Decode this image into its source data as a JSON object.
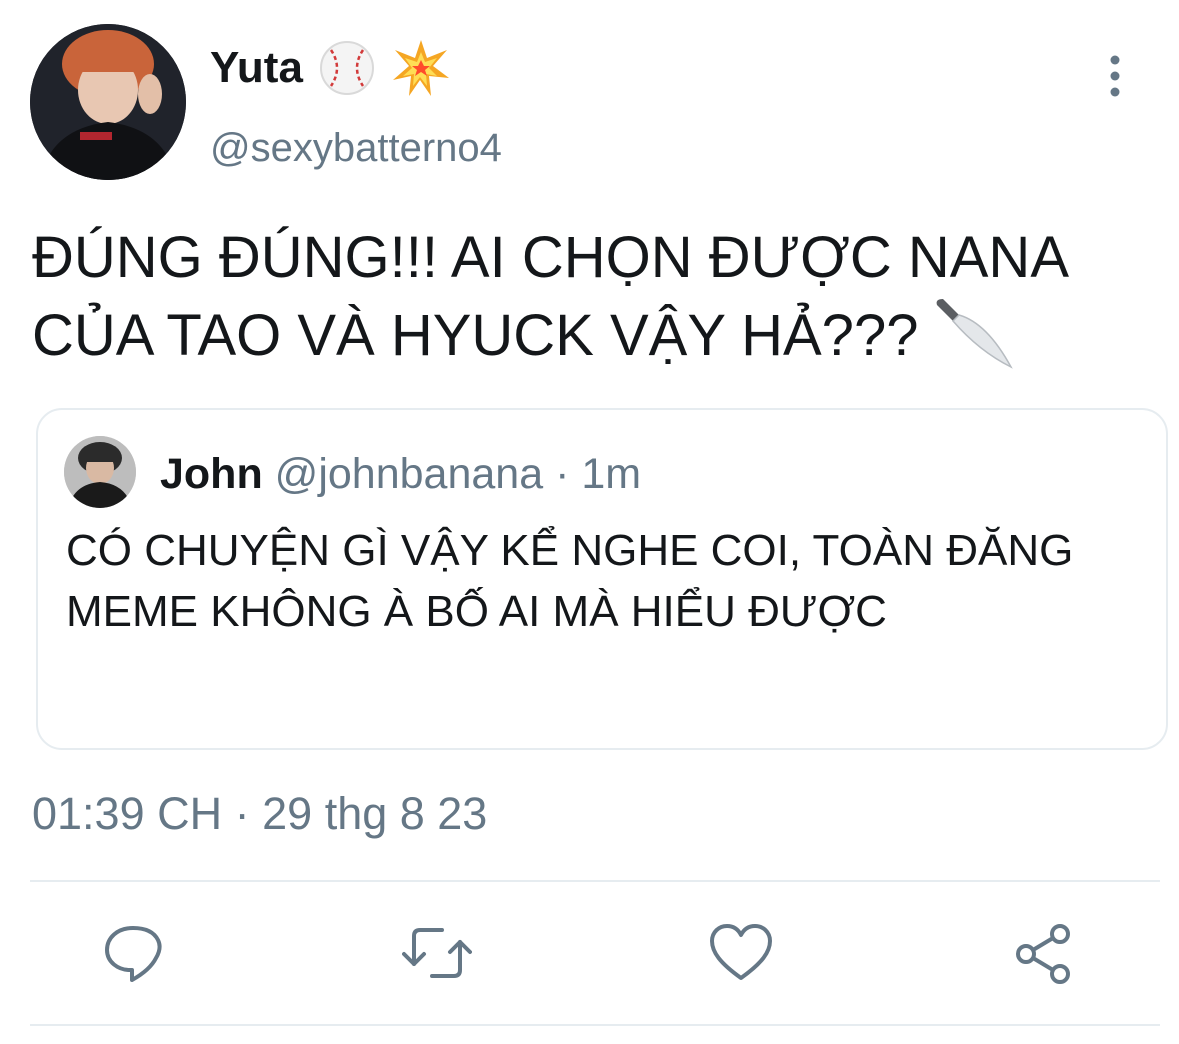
{
  "author": {
    "display_name": "Yuta",
    "handle": "@sexybatterno4",
    "name_emojis": [
      "baseball-emoji",
      "collision-emoji"
    ]
  },
  "tweet": {
    "line1": "ĐÚNG ĐÚNG!!! AI CHỌN ĐƯỢC NANA",
    "line2": "CỦA TAO VÀ HYUCK VẬY HẢ???",
    "trailing_emoji": "kitchen-knife-emoji"
  },
  "quoted_tweet": {
    "name": "John",
    "handle": "@johnbanana",
    "separator": "·",
    "time": "1m",
    "text": "CÓ CHUYỆN GÌ VẬY KỂ NGHE COI, TOÀN ĐĂNG MEME KHÔNG À BỐ AI MÀ HIỂU ĐƯỢC"
  },
  "meta": {
    "time": "01:39 CH",
    "separator": "·",
    "date": "29 thg 8 23"
  },
  "actions": [
    {
      "name": "reply",
      "icon": "reply-icon"
    },
    {
      "name": "retweet",
      "icon": "retweet-icon"
    },
    {
      "name": "like",
      "icon": "heart-icon"
    },
    {
      "name": "share",
      "icon": "share-icon"
    }
  ],
  "colors": {
    "text_primary": "#14171a",
    "text_secondary": "#657786",
    "divider": "#e6ecf0",
    "icon": "#657786"
  }
}
